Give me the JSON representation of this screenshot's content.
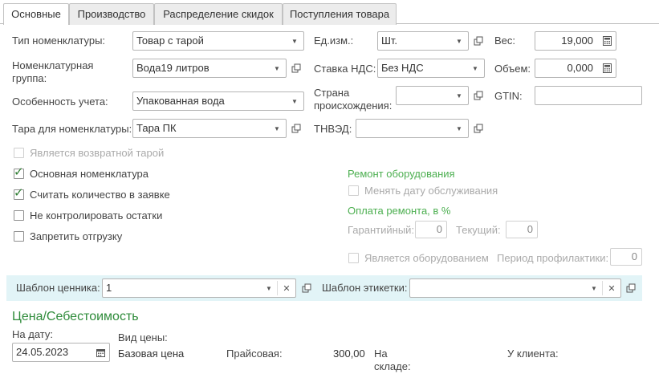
{
  "tabs": [
    {
      "label": "Основные",
      "active": true
    },
    {
      "label": "Производство",
      "active": false
    },
    {
      "label": "Распределение скидок",
      "active": false
    },
    {
      "label": "Поступления товара",
      "active": false
    }
  ],
  "form": {
    "nomenclature_type_label": "Тип номенклатуры:",
    "nomenclature_type_value": "Товар с тарой",
    "nomenclature_group_label_1": "Номенклатурная",
    "nomenclature_group_label_2": "группа:",
    "nomenclature_group_value": "Вода19 литров",
    "accounting_feature_label": "Особенность учета:",
    "accounting_feature_value": "Упакованная вода",
    "tare_label": "Тара для номенклатуры:",
    "tare_value": "Тара ПК",
    "unit_label": "Ед.изм.:",
    "unit_value": "Шт.",
    "vat_label": "Ставка НДС:",
    "vat_value": "Без НДС",
    "country_label_1": "Страна",
    "country_label_2": "происхождения:",
    "country_value": "",
    "tnved_label": "ТНВЭД:",
    "tnved_value": "",
    "weight_label": "Вес:",
    "weight_value": "19,000",
    "volume_label": "Объем:",
    "volume_value": "0,000",
    "gtin_label": "GTIN:",
    "gtin_value": ""
  },
  "checkboxes": {
    "returnable_tare": {
      "label": "Является возвратной тарой",
      "checked": false,
      "enabled": false
    },
    "main_nomenclature": {
      "label": "Основная номенклатура",
      "checked": true,
      "enabled": true
    },
    "count_in_order": {
      "label": "Считать количество в заявке",
      "checked": true,
      "enabled": true
    },
    "no_stock_control": {
      "label": "Не контролировать остатки",
      "checked": false,
      "enabled": true
    },
    "forbid_shipment": {
      "label": "Запретить отгрузку",
      "checked": false,
      "enabled": true
    }
  },
  "repair": {
    "heading": "Ремонт оборудования",
    "change_service_date": "Менять дату обслуживания",
    "payment_heading": "Оплата ремонта, в %",
    "warranty_label": "Гарантийный:",
    "warranty_value": "0",
    "current_label": "Текущий:",
    "current_value": "0",
    "is_equipment": "Является оборудованием",
    "prophylaxis_label": "Период профилактики:",
    "prophylaxis_value": "0"
  },
  "templates": {
    "price_tag_label": "Шаблон ценника:",
    "price_tag_value": "1",
    "label_template_label": "Шаблон этикетки:",
    "label_template_value": ""
  },
  "price": {
    "heading": "Цена/Себестоимость",
    "date_label": "На дату:",
    "date_value": "24.05.2023",
    "price_type_label": "Вид цены:",
    "price_type_value": "Базовая цена",
    "price_list_label": "Прайсовая:",
    "price_list_value": "300,00",
    "in_stock_label_1": "На",
    "in_stock_label_2": "складе:",
    "client_label": "У клиента:"
  },
  "colors": {
    "accent_green": "#4caf50",
    "check_green": "#2e7d32",
    "band": "#e2f4f7"
  }
}
